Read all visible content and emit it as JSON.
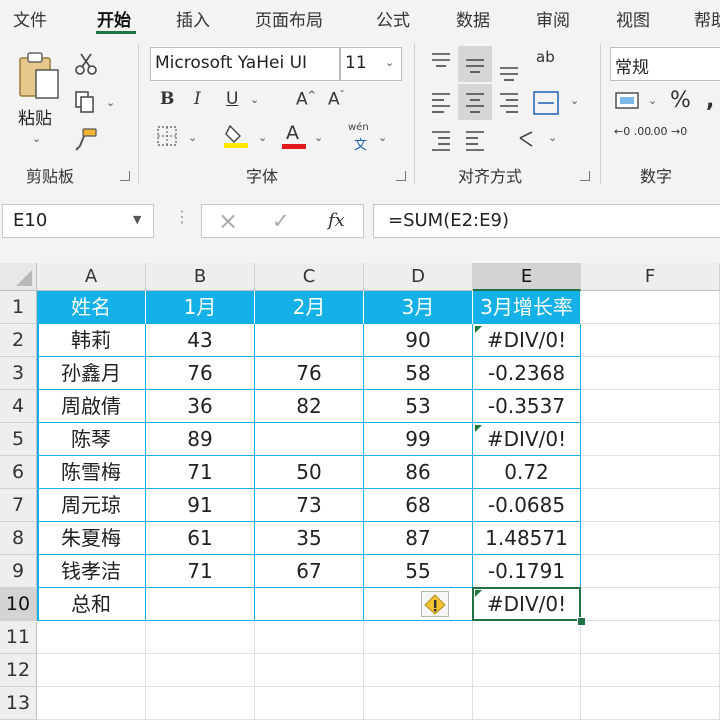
{
  "tabs": [
    "文件",
    "开始",
    "插入",
    "页面布局",
    "公式",
    "数据",
    "审阅",
    "视图",
    "帮助"
  ],
  "active_tab": "开始",
  "clipboard": {
    "paste_label": "粘贴",
    "group_label": "剪贴板"
  },
  "font": {
    "family": "Microsoft YaHei UI",
    "size": "11",
    "bold": "B",
    "italic": "I",
    "underline": "U",
    "grow": "A",
    "shrink": "A",
    "phonetic_top": "wén",
    "phonetic_bottom": "文",
    "font_color_letter": "A",
    "group_label": "字体",
    "fill_color": "#ffe600",
    "font_color": "#e21a1a"
  },
  "alignment": {
    "group_label": "对齐方式",
    "wrap_glyph": "ab"
  },
  "number": {
    "format": "常规",
    "percent": "%",
    "inc_decimals": "←0 .00",
    "dec_decimals": ".00 →0",
    "group_label": "数字"
  },
  "formula_bar": {
    "name_box": "E10",
    "cancel": "×",
    "enter": "✓",
    "fx": "fx",
    "formula": "=SUM(E2:E9)"
  },
  "sheet": {
    "columns": [
      "A",
      "B",
      "C",
      "D",
      "E",
      "F"
    ],
    "selected_column": "E",
    "selected_row": "10",
    "header_color": "#14b0e8",
    "error_marker_color": "#1f7a3e",
    "rows": [
      {
        "n": "1",
        "cells": [
          "姓名",
          "1月",
          "2月",
          "3月",
          "3月增长率",
          ""
        ]
      },
      {
        "n": "2",
        "cells": [
          "韩莉",
          "43",
          "",
          "90",
          "#DIV/0!",
          ""
        ]
      },
      {
        "n": "3",
        "cells": [
          "孙鑫月",
          "76",
          "76",
          "58",
          "-0.2368",
          ""
        ]
      },
      {
        "n": "4",
        "cells": [
          "周啟倩",
          "36",
          "82",
          "53",
          "-0.3537",
          ""
        ]
      },
      {
        "n": "5",
        "cells": [
          "陈琴",
          "89",
          "",
          "99",
          "#DIV/0!",
          ""
        ]
      },
      {
        "n": "6",
        "cells": [
          "陈雪梅",
          "71",
          "50",
          "86",
          "0.72",
          ""
        ]
      },
      {
        "n": "7",
        "cells": [
          "周元琼",
          "91",
          "73",
          "68",
          "-0.0685",
          ""
        ]
      },
      {
        "n": "8",
        "cells": [
          "朱夏梅",
          "61",
          "35",
          "87",
          "1.48571",
          ""
        ]
      },
      {
        "n": "9",
        "cells": [
          "钱孝洁",
          "71",
          "67",
          "55",
          "-0.1791",
          ""
        ]
      },
      {
        "n": "10",
        "cells": [
          "总和",
          "",
          "",
          "",
          "#DIV/0!",
          ""
        ]
      },
      {
        "n": "11",
        "cells": [
          "",
          "",
          "",
          "",
          "",
          ""
        ]
      },
      {
        "n": "12",
        "cells": [
          "",
          "",
          "",
          "",
          "",
          ""
        ]
      },
      {
        "n": "13",
        "cells": [
          "",
          "",
          "",
          "",
          "",
          ""
        ]
      }
    ],
    "error_indicator_icon": "warning-icon",
    "error_triangle_cells": [
      "E2",
      "E5",
      "E10"
    ]
  }
}
